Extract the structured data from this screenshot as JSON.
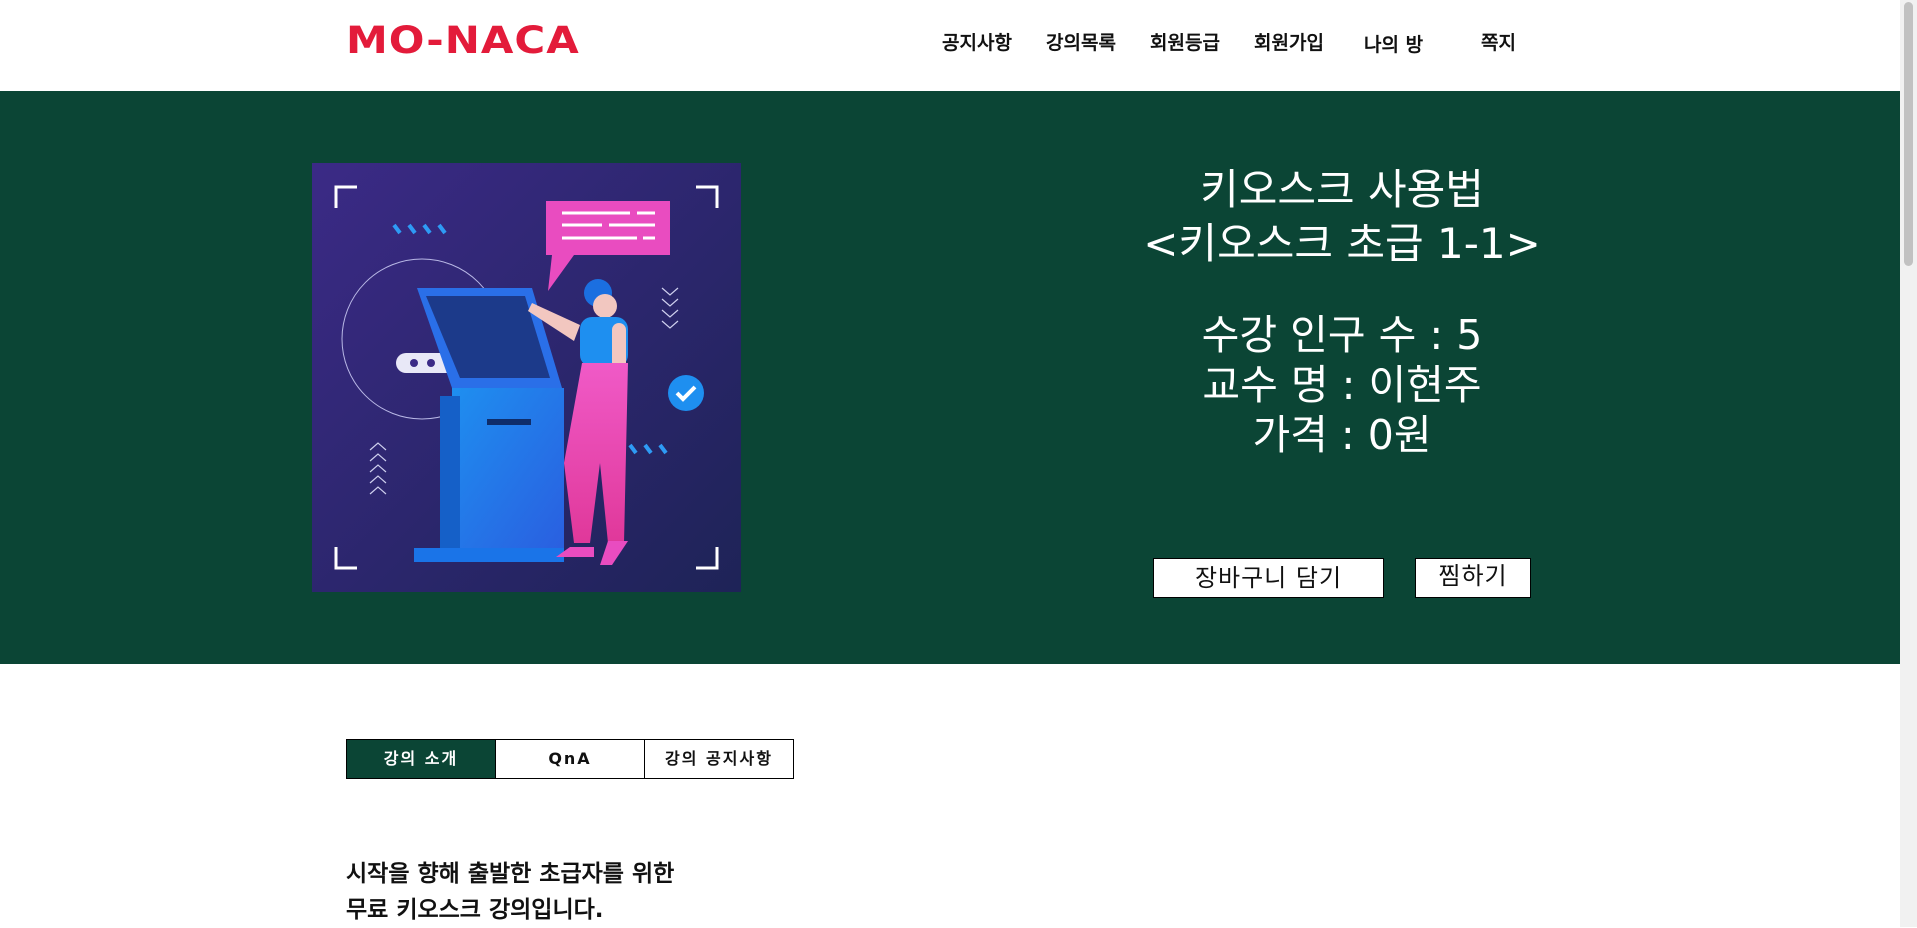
{
  "brand": {
    "logo_text": "MO-NACA",
    "logo_color": "#e31b3a",
    "hero_color": "#0b4535"
  },
  "nav": {
    "items": [
      {
        "label": "공지사항"
      },
      {
        "label": "강의목록"
      },
      {
        "label": "회원등급"
      },
      {
        "label": "회원가입"
      },
      {
        "label": "나의 방"
      },
      {
        "label": "쪽지"
      }
    ]
  },
  "course": {
    "title_line1": "키오스크 사용법",
    "title_line2": "<키오스크 초급 1-1>",
    "students": "수강 인구 수 : 5",
    "professor": "교수 명 : 이현주",
    "price": "가격 : 0원",
    "image_alt": "kiosk illustration"
  },
  "actions": {
    "cart_label": "장바구니 담기",
    "wish_label": "찜하기"
  },
  "tabs": [
    {
      "label": "강의 소개",
      "active": true
    },
    {
      "label": "QnA",
      "active": false
    },
    {
      "label": "강의 공지사항",
      "active": false
    }
  ],
  "intro": {
    "line1": "시작을 향해 출발한 초급자를 위한",
    "line2": "무료 키오스크 강의입니다."
  }
}
